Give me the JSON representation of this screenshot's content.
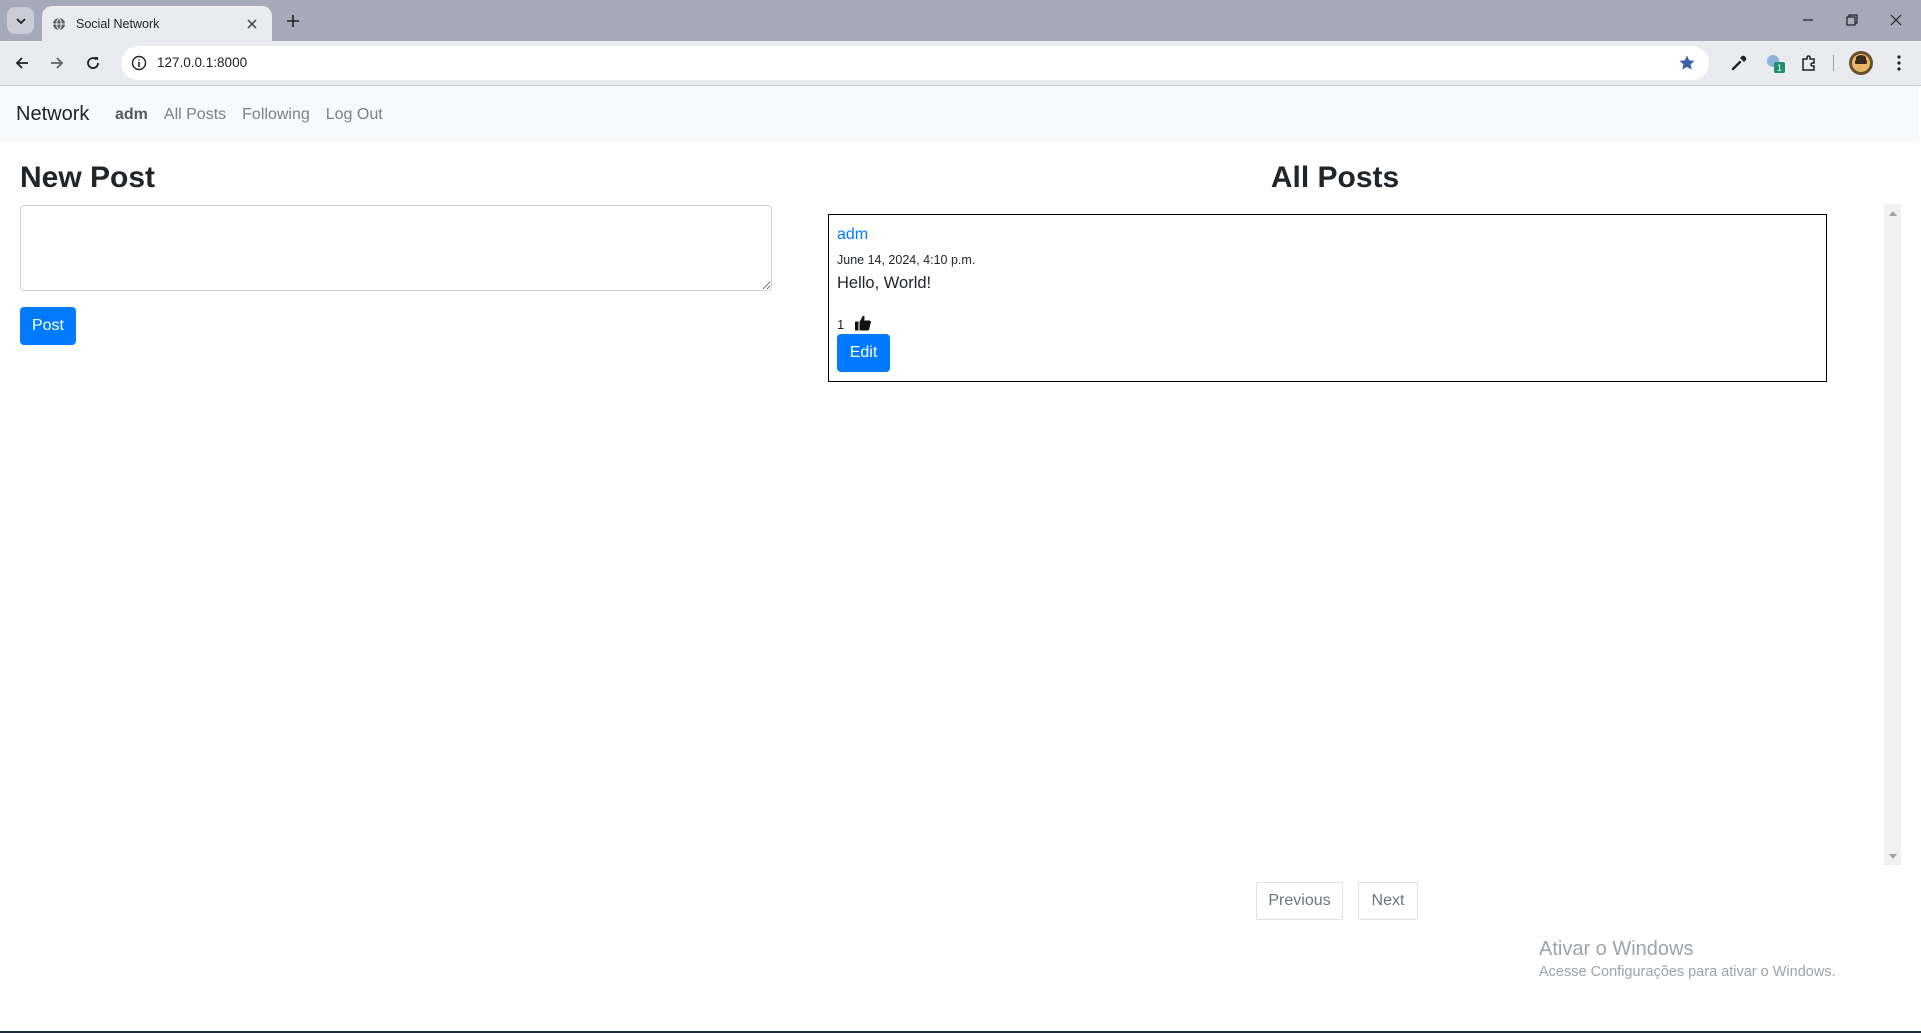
{
  "browser": {
    "tab_title": "Social Network",
    "url": "127.0.0.1:8000",
    "extension_badge": "1"
  },
  "navbar": {
    "brand": "Network",
    "user": "adm",
    "links": [
      "All Posts",
      "Following",
      "Log Out"
    ]
  },
  "new_post": {
    "title": "New Post",
    "textarea_value": "",
    "button_label": "Post"
  },
  "all_posts": {
    "title": "All Posts",
    "posts": [
      {
        "author": "adm",
        "timestamp": "June 14, 2024, 4:10 p.m.",
        "content": "Hello, World!",
        "likes": "1",
        "edit_label": "Edit"
      }
    ]
  },
  "pagination": {
    "previous": "Previous",
    "next": "Next"
  },
  "os_watermark": {
    "title": "Ativar o Windows",
    "subtitle": "Acesse Configurações para ativar o Windows."
  },
  "colors": {
    "primary": "#007bff",
    "navbar_bg": "#f8f9fa",
    "tabstrip_bg": "#a5aab8"
  },
  "icons": [
    "chevron-down-icon",
    "globe-icon",
    "close-icon",
    "plus-icon",
    "minimize-icon",
    "restore-icon",
    "back-icon",
    "forward-icon",
    "reload-icon",
    "site-info-icon",
    "star-icon",
    "eyedropper-icon",
    "extension-badge-icon",
    "puzzle-icon",
    "avatar",
    "kebab-menu-icon",
    "thumbs-up-icon"
  ]
}
